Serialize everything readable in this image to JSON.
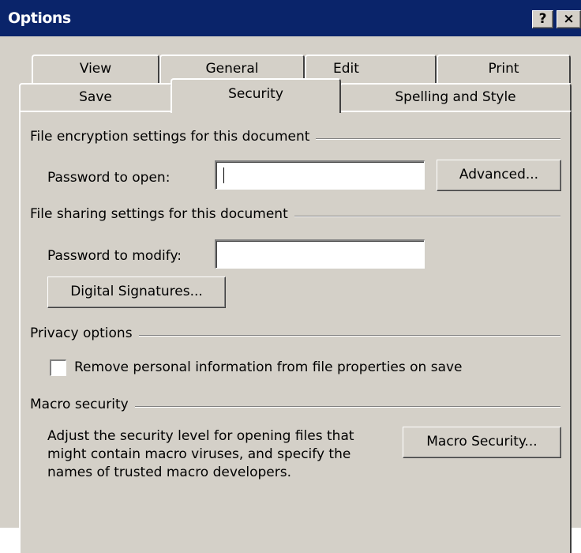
{
  "window": {
    "title": "Options",
    "help_glyph": "?",
    "close_glyph": "×"
  },
  "tabs": {
    "row1": [
      "View",
      "General",
      "Edit",
      "Print"
    ],
    "row2": [
      "Save",
      "Security",
      "Spelling and Style"
    ],
    "active": "Security"
  },
  "encryption": {
    "heading": "File encryption settings for this document",
    "password_label": "Password to open:",
    "password_value": "",
    "advanced_button": "Advanced..."
  },
  "sharing": {
    "heading": "File sharing settings for this document",
    "password_label": "Password to modify:",
    "password_value": "",
    "signatures_button": "Digital Signatures..."
  },
  "privacy": {
    "heading": "Privacy options",
    "remove_info_label": "Remove personal information from file properties on save",
    "remove_info_checked": false
  },
  "macro": {
    "heading": "Macro security",
    "description": "Adjust the security level for opening files that might contain macro viruses, and specify the names of trusted macro developers.",
    "button": "Macro Security..."
  },
  "colors": {
    "titlebar": "#0a246a",
    "face": "#d4d0c8"
  }
}
